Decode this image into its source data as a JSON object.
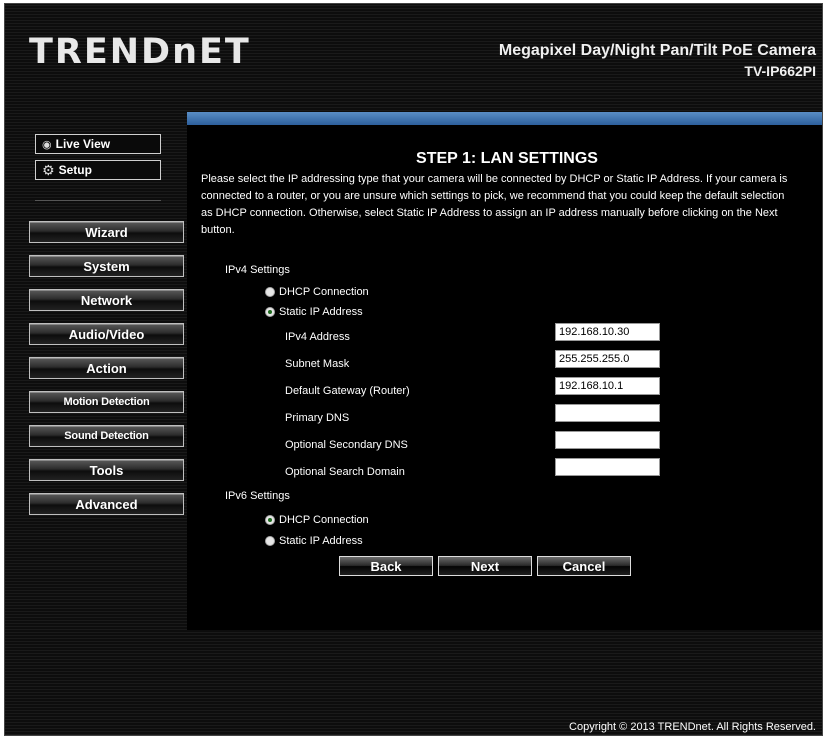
{
  "header": {
    "brand": "TRENDnET",
    "product_title": "Megapixel Day/Night Pan/Tilt PoE Camera",
    "model": "TV-IP662PI"
  },
  "view_buttons": [
    {
      "label": "Live View",
      "icon": "eye-icon"
    },
    {
      "label": "Setup",
      "icon": "gear-icon"
    }
  ],
  "nav": {
    "items": [
      "Wizard",
      "System",
      "Network",
      "Audio/Video",
      "Action",
      "Motion Detection",
      "Sound Detection",
      "Tools",
      "Advanced"
    ]
  },
  "step": {
    "title": "STEP 1: LAN SETTINGS",
    "description": "Please select the IP addressing type that your camera will be connected by DHCP or Static IP Address. If your camera is connected to a router, or you are unsure which settings to pick, we recommend that you could keep the default selection as DHCP connection. Otherwise, select Static IP Address to assign an IP address manually before clicking on the Next button."
  },
  "ipv4": {
    "label": "IPv4 Settings",
    "options": [
      {
        "label": "DHCP Connection",
        "selected": false
      },
      {
        "label": "Static IP Address",
        "selected": true
      }
    ],
    "fields": [
      {
        "label": "IPv4 Address",
        "value": "192.168.10.30"
      },
      {
        "label": "Subnet Mask",
        "value": "255.255.255.0"
      },
      {
        "label": "Default Gateway (Router)",
        "value": "192.168.10.1"
      },
      {
        "label": "Primary DNS",
        "value": ""
      },
      {
        "label": "Optional Secondary DNS",
        "value": ""
      },
      {
        "label": "Optional Search Domain",
        "value": ""
      }
    ]
  },
  "ipv6": {
    "label": "IPv6 Settings",
    "options": [
      {
        "label": "DHCP Connection",
        "selected": true
      },
      {
        "label": "Static IP Address",
        "selected": false
      }
    ]
  },
  "actions": {
    "back": "Back",
    "next": "Next",
    "cancel": "Cancel"
  },
  "footer": {
    "copyright": "Copyright © 2013 TRENDnet. All Rights Reserved."
  },
  "colors": {
    "accent_bar": "#3f77b4",
    "panel_bg": "#000000",
    "radio_dot": "#1f6b1f"
  }
}
